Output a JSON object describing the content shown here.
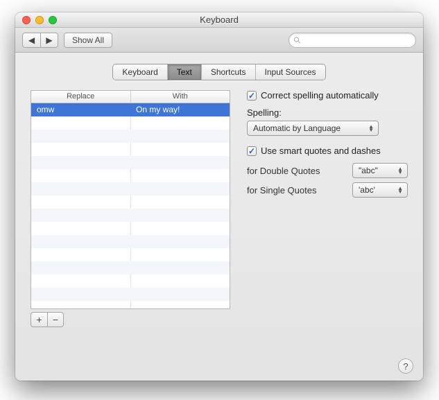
{
  "title": "Keyboard",
  "toolbar": {
    "show_all": "Show All",
    "search_placeholder": ""
  },
  "tabs": [
    {
      "label": "Keyboard",
      "active": false
    },
    {
      "label": "Text",
      "active": true
    },
    {
      "label": "Shortcuts",
      "active": false
    },
    {
      "label": "Input Sources",
      "active": false
    }
  ],
  "table": {
    "col1": "Replace",
    "col2": "With",
    "rows": [
      {
        "replace": "omw",
        "with": "On my way!",
        "selected": true
      }
    ]
  },
  "buttons": {
    "add": "+",
    "remove": "−"
  },
  "right": {
    "correct_spelling": "Correct spelling automatically",
    "spelling_label": "Spelling:",
    "spelling_value": "Automatic by Language",
    "smart_quotes": "Use smart quotes and dashes",
    "double_label": "for Double Quotes",
    "double_value": "\"abc\"",
    "single_label": "for Single Quotes",
    "single_value": "'abc'"
  },
  "help": "?"
}
